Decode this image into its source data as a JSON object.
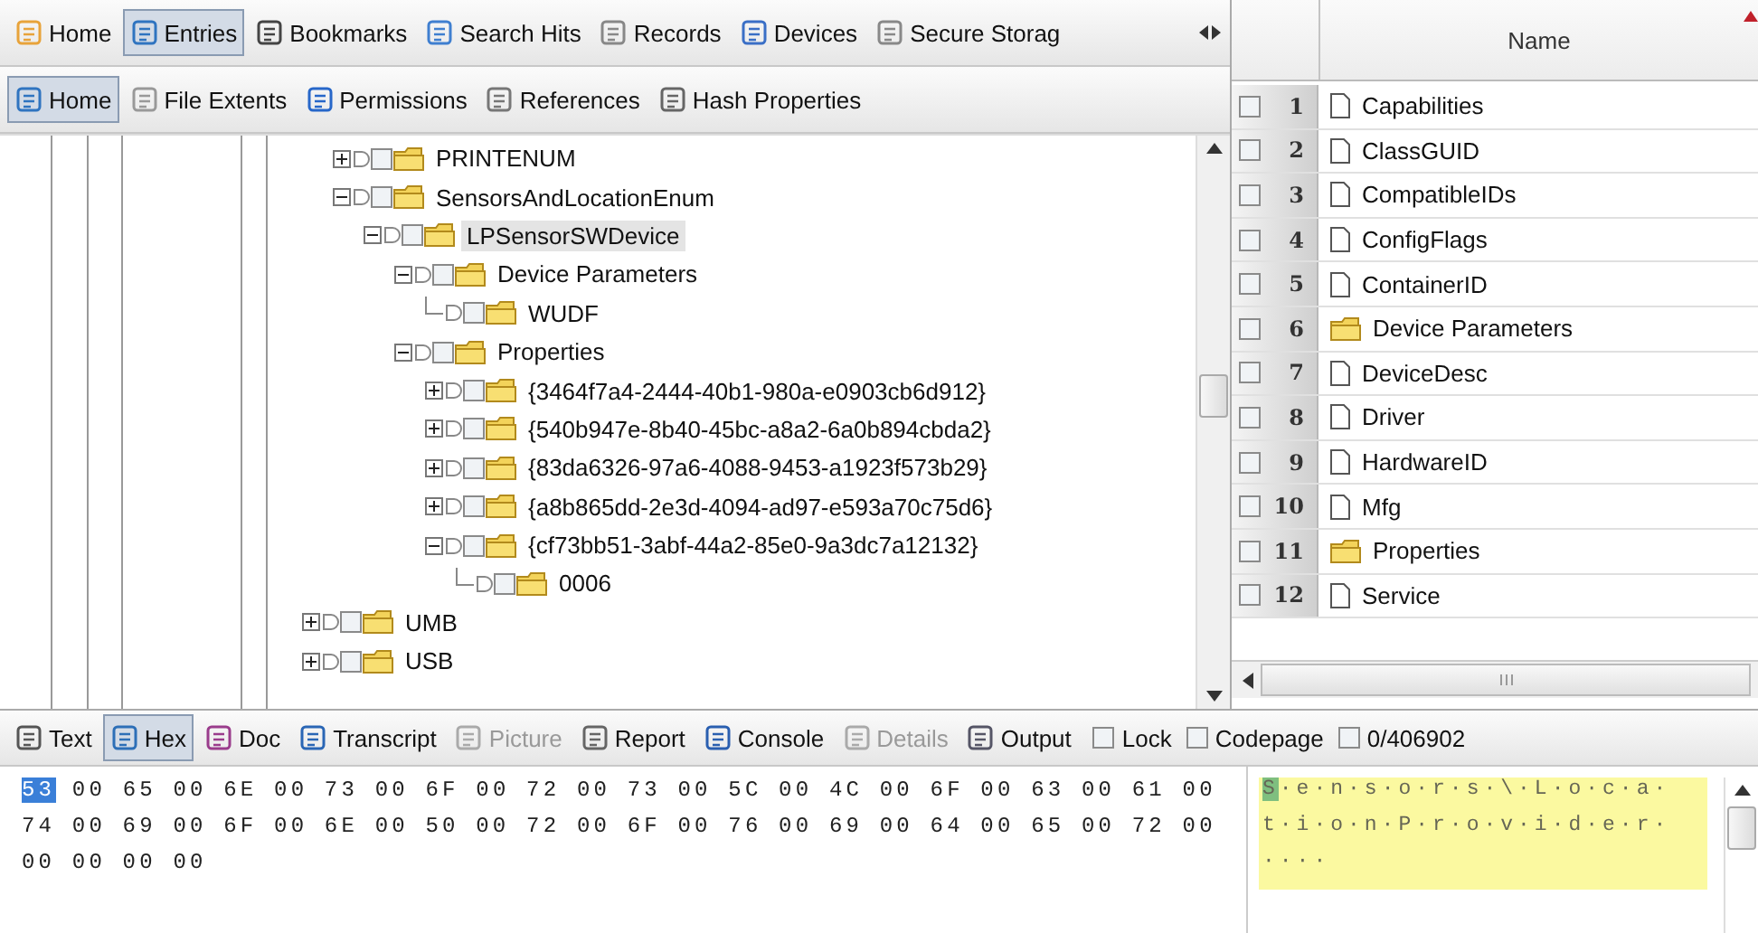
{
  "main_tabs": [
    {
      "label": "Home",
      "selected": false
    },
    {
      "label": "Entries",
      "selected": true
    },
    {
      "label": "Bookmarks",
      "selected": false
    },
    {
      "label": "Search Hits",
      "selected": false
    },
    {
      "label": "Records",
      "selected": false
    },
    {
      "label": "Devices",
      "selected": false
    },
    {
      "label": "Secure Storag",
      "selected": false
    }
  ],
  "sub_tabs": [
    {
      "label": "Home",
      "selected": true
    },
    {
      "label": "File Extents",
      "selected": false
    },
    {
      "label": "Permissions",
      "selected": false
    },
    {
      "label": "References",
      "selected": false
    },
    {
      "label": "Hash Properties",
      "selected": false
    }
  ],
  "tree": {
    "nested_items": [
      {
        "label": "PRINTENUM",
        "kind": "branch",
        "expanded": false,
        "selected": false,
        "checked": false
      },
      {
        "label": "SensorsAndLocationEnum",
        "kind": "branch",
        "expanded": true,
        "selected": false,
        "checked": false,
        "children": [
          {
            "label": "LPSensorSWDevice",
            "kind": "branch",
            "expanded": true,
            "selected": true,
            "checked": false,
            "children": [
              {
                "label": "Device Parameters",
                "kind": "branch",
                "expanded": true,
                "selected": false,
                "checked": false,
                "children": [
                  {
                    "label": "WUDF",
                    "kind": "leaf",
                    "selected": false,
                    "checked": false
                  }
                ]
              },
              {
                "label": "Properties",
                "kind": "branch",
                "expanded": true,
                "selected": false,
                "checked": false,
                "children": [
                  {
                    "label": "{3464f7a4-2444-40b1-980a-e0903cb6d912}",
                    "kind": "branch",
                    "expanded": false,
                    "selected": false,
                    "checked": false
                  },
                  {
                    "label": "{540b947e-8b40-45bc-a8a2-6a0b894cbda2}",
                    "kind": "branch",
                    "expanded": false,
                    "selected": false,
                    "checked": false
                  },
                  {
                    "label": "{83da6326-97a6-4088-9453-a1923f573b29}",
                    "kind": "branch",
                    "expanded": false,
                    "selected": false,
                    "checked": false
                  },
                  {
                    "label": "{a8b865dd-2e3d-4094-ad97-e593a70c75d6}",
                    "kind": "branch",
                    "expanded": false,
                    "selected": false,
                    "checked": false
                  },
                  {
                    "label": "{cf73bb51-3abf-44a2-85e0-9a3dc7a12132}",
                    "kind": "branch",
                    "expanded": true,
                    "selected": false,
                    "checked": false,
                    "children": [
                      {
                        "label": "0006",
                        "kind": "leaf",
                        "selected": false,
                        "checked": false
                      }
                    ]
                  }
                ]
              }
            ]
          }
        ]
      }
    ],
    "items": [
      {
        "label": "UMB",
        "kind": "branch",
        "expanded": false,
        "selected": false,
        "checked": false
      },
      {
        "label": "USB",
        "kind": "branch",
        "expanded": false,
        "selected": false,
        "checked": false
      }
    ]
  },
  "table": {
    "columns": [
      "Name"
    ],
    "rows": [
      {
        "number": "1",
        "kind": "file",
        "name": "Capabilities",
        "checked": false
      },
      {
        "number": "2",
        "kind": "file",
        "name": "ClassGUID",
        "checked": false
      },
      {
        "number": "3",
        "kind": "file",
        "name": "CompatibleIDs",
        "checked": false
      },
      {
        "number": "4",
        "kind": "file",
        "name": "ConfigFlags",
        "checked": false
      },
      {
        "number": "5",
        "kind": "file",
        "name": "ContainerID",
        "checked": false
      },
      {
        "number": "6",
        "kind": "folder",
        "name": "Device Parameters",
        "checked": false
      },
      {
        "number": "7",
        "kind": "file",
        "name": "DeviceDesc",
        "checked": false
      },
      {
        "number": "8",
        "kind": "file",
        "name": "Driver",
        "checked": false
      },
      {
        "number": "9",
        "kind": "file",
        "name": "HardwareID",
        "checked": false
      },
      {
        "number": "10",
        "kind": "file",
        "name": "Mfg",
        "checked": false
      },
      {
        "number": "11",
        "kind": "folder",
        "name": "Properties",
        "checked": false
      },
      {
        "number": "12",
        "kind": "file",
        "name": "Service",
        "checked": false
      }
    ]
  },
  "view_tabs": [
    {
      "label": "Text",
      "selected": false,
      "disabled": false
    },
    {
      "label": "Hex",
      "selected": true,
      "disabled": false
    },
    {
      "label": "Doc",
      "selected": false,
      "disabled": false
    },
    {
      "label": "Transcript",
      "selected": false,
      "disabled": false
    },
    {
      "label": "Picture",
      "selected": false,
      "disabled": true
    },
    {
      "label": "Report",
      "selected": false,
      "disabled": false
    },
    {
      "label": "Console",
      "selected": false,
      "disabled": false
    },
    {
      "label": "Details",
      "selected": false,
      "disabled": true
    },
    {
      "label": "Output",
      "selected": false,
      "disabled": false
    }
  ],
  "view_options": [
    {
      "label": "Lock",
      "checked": false
    },
    {
      "label": "Codepage",
      "checked": false
    },
    {
      "label": "0/406902",
      "checked": false
    }
  ],
  "hex_lines": [
    [
      {
        "text": "53",
        "selected": true
      },
      {
        "text": " 00 65 00 6E 00 73 00 6F 00 72 00 73 00 5C 00 4C 00 6F 00 63 00 61 00",
        "selected": false
      }
    ],
    [
      {
        "text": "74 00 69 00 6F 00 6E 00 50 00 72 00 6F 00 76 00 69 00 64 00 65 00 72 00",
        "selected": false
      }
    ],
    [
      {
        "text": "00 00 00 00",
        "selected": false
      }
    ]
  ],
  "text_lines": [
    [
      {
        "text": "S",
        "selected": true
      },
      {
        "text": "·e·n·s·o·r·s·\\·L·o·c·a·",
        "selected": false
      }
    ],
    [
      {
        "text": "t·i·o·n·P·r·o·v·i·d·e·r·",
        "selected": false
      }
    ],
    [
      {
        "text": "····",
        "selected": false
      }
    ]
  ]
}
